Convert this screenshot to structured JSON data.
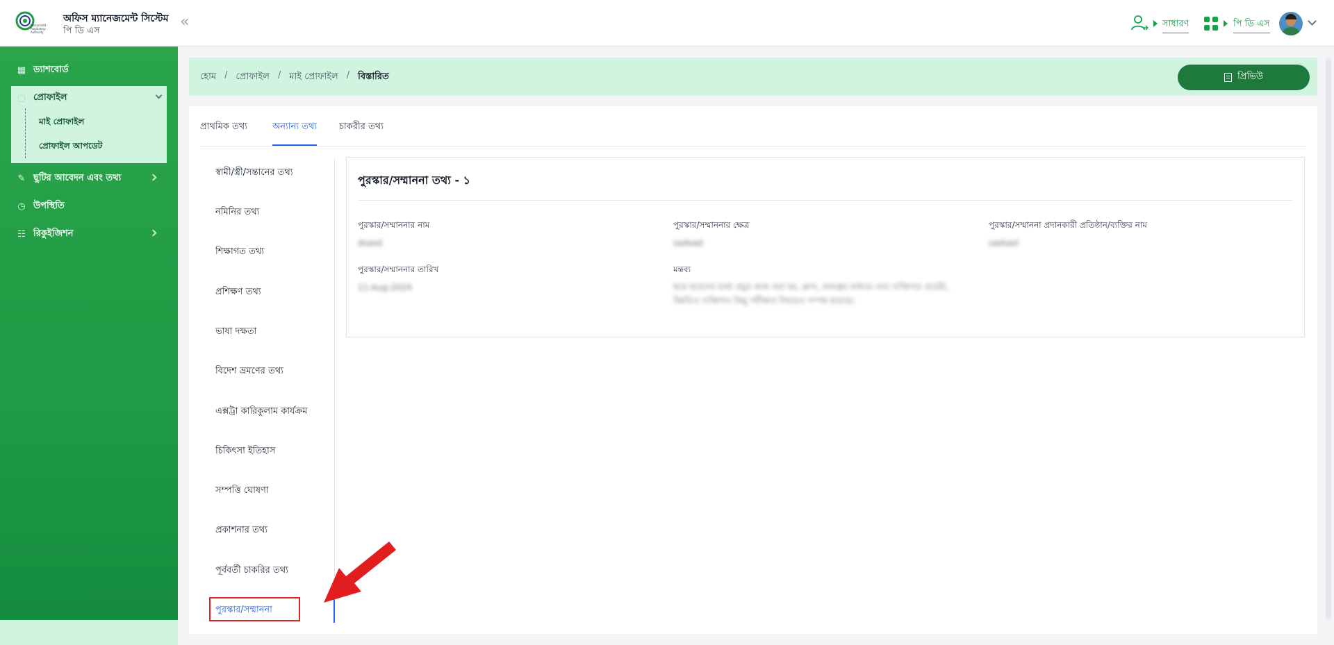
{
  "app": {
    "title": "অফিস ম্যানেজমেন্ট সিস্টেম",
    "subtitle": "পি ডি এস",
    "logo_text": "Microcredit Regulatory Authority"
  },
  "topbar": {
    "role_link": "সাধারণ",
    "module_link": "পি ডি এস",
    "collapse_glyph": "«"
  },
  "sidebar": {
    "items": [
      {
        "label": "ড্যাশবোর্ড",
        "icon": "dashboard-icon"
      },
      {
        "label": "প্রোফাইল",
        "icon": "profile-icon"
      },
      {
        "label": "ছুটির আবেদন এবং তথ্য",
        "icon": "leave-icon"
      },
      {
        "label": "উপস্থিতি",
        "icon": "clock-icon"
      },
      {
        "label": "রিকুইজিশন",
        "icon": "requisition-icon"
      }
    ],
    "profile_sub": [
      "মাই প্রোফাইল",
      "প্রোফাইল আপডেট"
    ]
  },
  "breadcrumb": [
    "হোম",
    "প্রোফাইল",
    "মাই প্রোফাইল",
    "বিস্তারিত"
  ],
  "preview_label": "প্রিভিউ",
  "tabs": [
    "প্রাথমিক তথ্য",
    "অন্যান্য তথ্য",
    "চাকরীর তথ্য"
  ],
  "active_tab": "অন্যান্য তথ্য",
  "side_menu": [
    "স্বামী/স্ত্রী/সন্তানের তথ্য",
    "নমিনির তথ্য",
    "শিক্ষাগত তথ্য",
    "প্রশিক্ষণ তথ্য",
    "ভাষা দক্ষতা",
    "বিদেশ ভ্রমণের তথ্য",
    "এক্সট্রা কারিকুলাম কার্যক্রম",
    "চিকিৎসা ইতিহাস",
    "সম্পত্তি ঘোষণা",
    "প্রকাশনার তথ্য",
    "পূর্ববর্তী চাকরির তথ্য",
    "পুরস্কার/সম্মাননা"
  ],
  "award": {
    "title": "পুরস্কার/সম্মাননা তথ্য - ১",
    "fields": [
      {
        "label": "পুরস্কার/সম্মাননার নাম",
        "value": "dsasd"
      },
      {
        "label": "পুরস্কার/সম্মাননার ক্ষেত্র",
        "value": "sadsad"
      },
      {
        "label": "পুরস্কার/সম্মাননা প্রদানকারী প্রতিষ্ঠান/ব্যক্তির নাম",
        "value": "sadsad"
      },
      {
        "label": "পুরস্কার/সম্মাননার তারিখ",
        "value": "11-Aug-2024"
      },
      {
        "label": "মন্তব্য",
        "value": "ছাত্র ছাত্রদের মধ্যে প্রচুর কাজ করা হয়, ক্লাস, প্রকল্পের মাধ্যমে এবং ব্যক্তিগত প্রচেষ্টা, উন্নতিও ব্যক্তিগত কিছু পরীক্ষার বিষয়েও সম্পন্ন হয়েছে।"
      }
    ]
  },
  "colors": {
    "brand_green": "#1f9a45",
    "accent_blue": "#2563eb",
    "highlight_red": "#dc2626",
    "light_green": "#d1f4e0"
  }
}
